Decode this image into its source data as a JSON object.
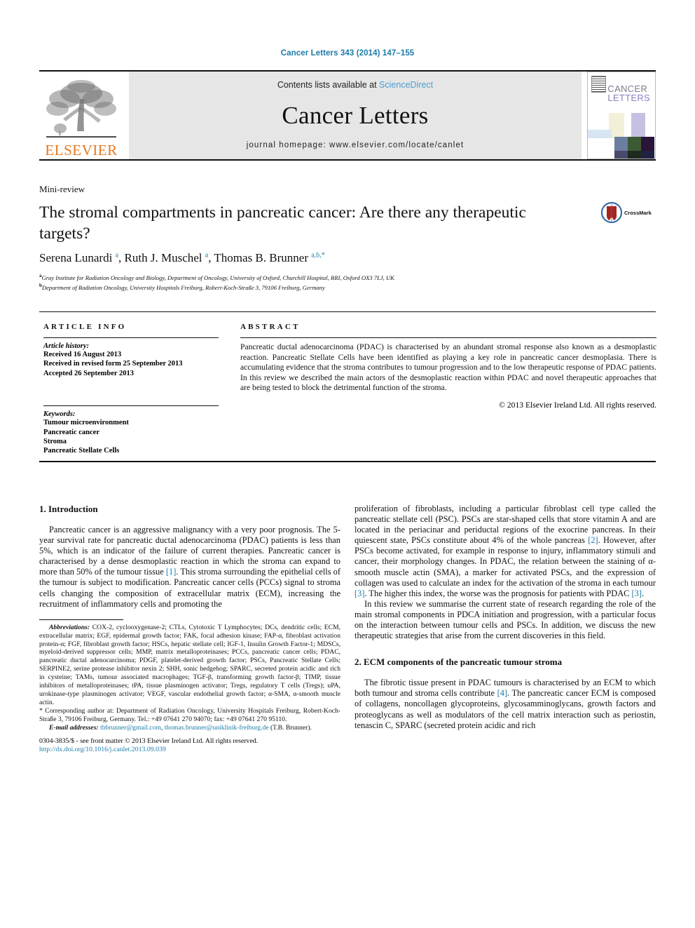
{
  "running_head": "Cancer Letters 343 (2014) 147–155",
  "masthead": {
    "publisher": "ELSEVIER",
    "contents_prefix": "Contents lists available at ",
    "contents_link": "ScienceDirect",
    "journal_title": "Cancer Letters",
    "homepage": "journal homepage: www.elsevier.com/locate/canlet",
    "cover_title_line1": "CANCER",
    "cover_title_line2": "LETTERS"
  },
  "article": {
    "type": "Mini-review",
    "title": "The stromal compartments in pancreatic cancer: Are there any therapeutic targets?",
    "crossmark_label": "CrossMark",
    "authors_html": "Serena Lunardi <sup>a</sup>, Ruth J. Muschel <sup>a</sup>, Thomas B. Brunner <sup>a,b,</sup><sup>*</sup>",
    "affiliation_a": "Gray Institute for Radiation Oncology and Biology, Department of Oncology, University of Oxford, Churchill Hospital, RRI, Oxford OX3 7LJ, UK",
    "affiliation_b": "Department of Radiation Oncology, University Hospitals Freiburg, Robert-Koch-Straße 3, 79106 Freiburg, Germany"
  },
  "info": {
    "heading": "ARTICLE INFO",
    "history_label": "Article history:",
    "history": [
      "Received 16 August 2013",
      "Received in revised form 25 September 2013",
      "Accepted 26 September 2013"
    ],
    "keywords_label": "Keywords:",
    "keywords": [
      "Tumour microenvironment",
      "Pancreatic cancer",
      "Stroma",
      "Pancreatic Stellate Cells"
    ]
  },
  "abstract": {
    "heading": "ABSTRACT",
    "text": "Pancreatic ductal adenocarcinoma (PDAC) is characterised by an abundant stromal response also known as a desmoplastic reaction. Pancreatic Stellate Cells have been identified as playing a key role in pancreatic cancer desmoplasia. There is accumulating evidence that the stroma contributes to tumour progression and to the low therapeutic response of PDAC patients. In this review we described the main actors of the desmoplastic reaction within PDAC and novel therapeutic approaches that are being tested to block the detrimental function of the stroma.",
    "copyright": "© 2013 Elsevier Ireland Ltd. All rights reserved."
  },
  "body": {
    "left": {
      "section1_heading": "1. Introduction",
      "para1_a": "Pancreatic cancer is an aggressive malignancy with a very poor prognosis. The 5-year survival rate for pancreatic ductal adenocarcinoma (PDAC) patients is less than 5%, which is an indicator of the failure of current therapies. Pancreatic cancer is characterised by a dense desmoplastic reaction in which the stroma can expand to more than 50% of the tumour tissue ",
      "para1_ref": "[1]",
      "para1_b": ". This stroma surrounding the epithelial cells of the tumour is subject to modification. Pancreatic cancer cells (PCCs) signal to stroma cells changing the composition of extracellular matrix (ECM), increasing the recruitment of inflammatory cells and promoting the"
    },
    "right": {
      "para_cont": "proliferation of fibroblasts, including a particular fibroblast cell type called the pancreatic stellate cell (PSC). PSCs are star-shaped cells that store vitamin A and are located in the periacinar and periductal regions of the exocrine pancreas. In their quiescent state, PSCs constitute about 4% of the whole pancreas ",
      "ref2": "[2]",
      "para_cont_b": ". However, after PSCs become activated, for example in response to injury, inflammatory stimuli and cancer, their morphology changes. In PDAC, the relation between the staining of α-smooth muscle actin (SMA), a marker for activated PSCs, and the expression of collagen was used to calculate an index for the activation of the stroma in each tumour ",
      "ref3a": "[3]",
      "para_cont_c": ". The higher this index, the worse was the prognosis for patients with PDAC ",
      "ref3b": "[3]",
      "para_cont_d": ".",
      "para2": "In this review we summarise the current state of research regarding the role of the main stromal components in PDCA initiation and progression, with a particular focus on the interaction between tumour cells and PSCs. In addition, we discuss the new therapeutic strategies that arise from the current discoveries in this field.",
      "section2_heading": "2. ECM components of the pancreatic tumour stroma",
      "para3_a": "The fibrotic tissue present in PDAC tumours is characterised by an ECM to which both tumour and stroma cells contribute ",
      "ref4": "[4]",
      "para3_b": ". The pancreatic cancer ECM is composed of collagens, noncollagen glycoproteins, glycosamminoglycans, growth factors and proteoglycans as well as modulators of the cell matrix interaction such as periostin, tenascin C, SPARC (secreted protein acidic and rich"
    }
  },
  "footnotes": {
    "abbrev_label": "Abbreviations:",
    "abbrev_text": " COX-2, cyclooxygenase-2; CTLs, Cytotoxic T Lymphocytes; DCs, dendritic cells; ECM, extracellular matrix; EGF, epidermal growth factor; FAK, focal adhesion kinase; FAP-α, fibroblast activation protein-α; FGF, fibroblast growth factor; HSCs, hepatic stellate cell; IGF-1, Insulin Growth Factor-1; MDSCs, myeloid-derived suppressor cells; MMP, matrix metalloproteinases; PCCs, pancreatic cancer cells; PDAC, pancreatic ductal adenocarcinoma; PDGF, platelet-derived growth factor; PSCs, Pancreatic Stellate Cells; SERPINE2, serine protease inhibitor nexin 2; SHH, sonic hedgehog; SPARC, secreted protein acidic and rich in cysteine; TAMs, tumour associated macrophages; TGF-β, transforming growth factor-β; TIMP, tissue inhibitors of metalloproteinases; tPA, tissue plasminogen activator; Tregs, regulatory T cells (Tregs); uPA, urokinase-type plasminogen activator; VEGF, vascular endothelial growth factor; α-SMA, α-smooth muscle actin.",
    "corresponding": "* Corresponding author at: Department of Radiation Oncology, University Hospitals Freiburg, Robert-Koch-Straße 3, 79106 Freiburg, Germany. Tel.: +49 07641 270 94070; fax: +49 07641 270 95110.",
    "email_label": "E-mail addresses:",
    "email_1": "tbbrunner@gmail.com",
    "email_sep": ", ",
    "email_2": "thomas.brunner@uniklinik-freiburg.de",
    "email_tail": " (T.B. Brunner).",
    "issn_line": "0304-3835/$ - see front matter © 2013 Elsevier Ireland Ltd. All rights reserved.",
    "doi_line": "http://dx.doi.org/10.1016/j.canlet.2013.09.039"
  },
  "colors": {
    "link": "#1a7ba8",
    "sciencedirect": "#4a9fd4",
    "elsevier_orange": "#E8781E",
    "crossmark_red": "#A8231F",
    "crossmark_blue": "#3C6FA8"
  }
}
